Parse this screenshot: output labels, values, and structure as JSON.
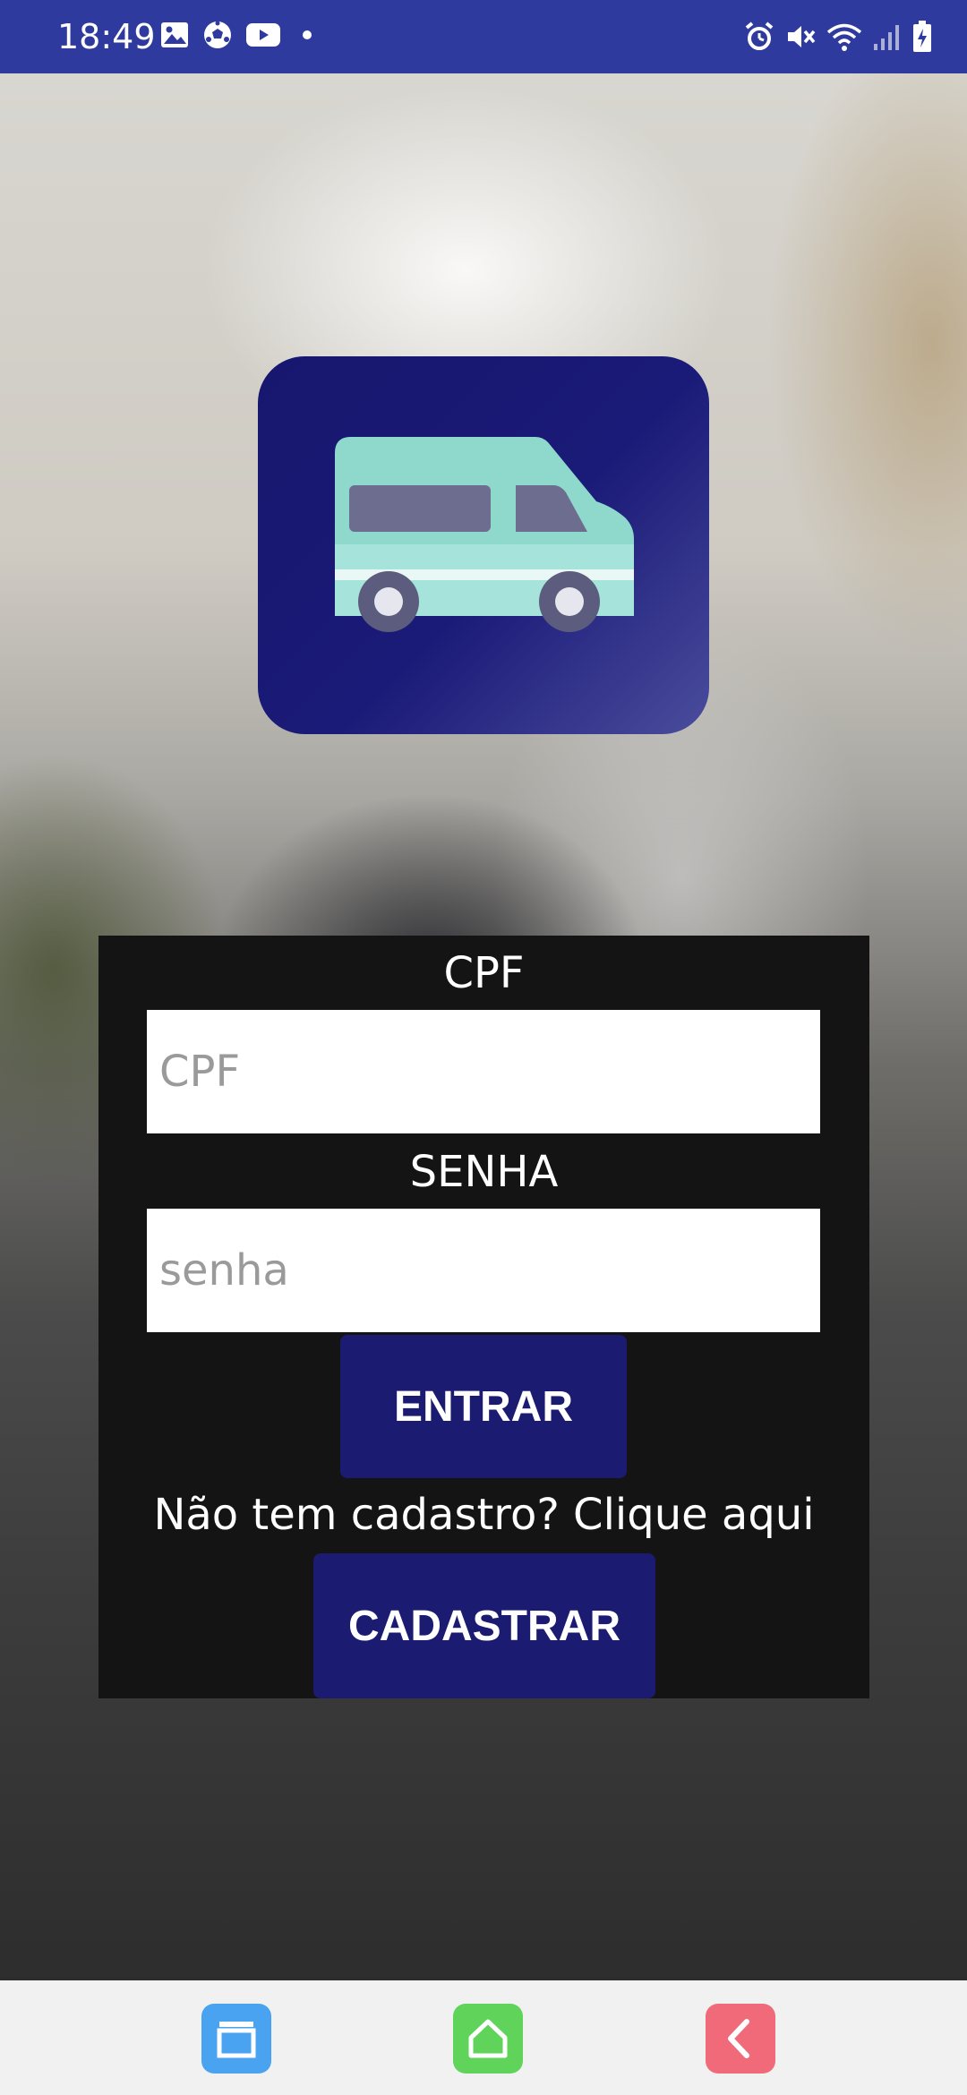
{
  "status_bar": {
    "time": "18:49",
    "left_icons": [
      "image-icon",
      "soccer-ball-icon",
      "youtube-icon",
      "dot-icon"
    ],
    "right_icons": [
      "alarm-icon",
      "mute-icon",
      "wifi-icon",
      "signal-icon",
      "battery-icon"
    ]
  },
  "logo": {
    "icon": "van-icon",
    "colors": {
      "tile": "#1a1a78",
      "van_body": "#8fd8cc",
      "windows": "#6d6d90"
    }
  },
  "login": {
    "cpf_label": "CPF",
    "cpf_placeholder": "CPF",
    "cpf_value": "",
    "senha_label": "SENHA",
    "senha_placeholder": "senha",
    "senha_value": "",
    "entrar_label": "ENTRAR",
    "signup_prompt": "Não tem cadastro? Clique aqui",
    "cadastrar_label": "CADASTRAR",
    "colors": {
      "panel": "#141414",
      "button": "#1b1b72",
      "text": "#ffffff"
    }
  },
  "nav_bar": {
    "icons": [
      "recents-icon",
      "home-icon",
      "back-icon"
    ],
    "colors": {
      "recents": "#4aa3f0",
      "home": "#5fd35a",
      "back": "#f06a7a"
    }
  }
}
